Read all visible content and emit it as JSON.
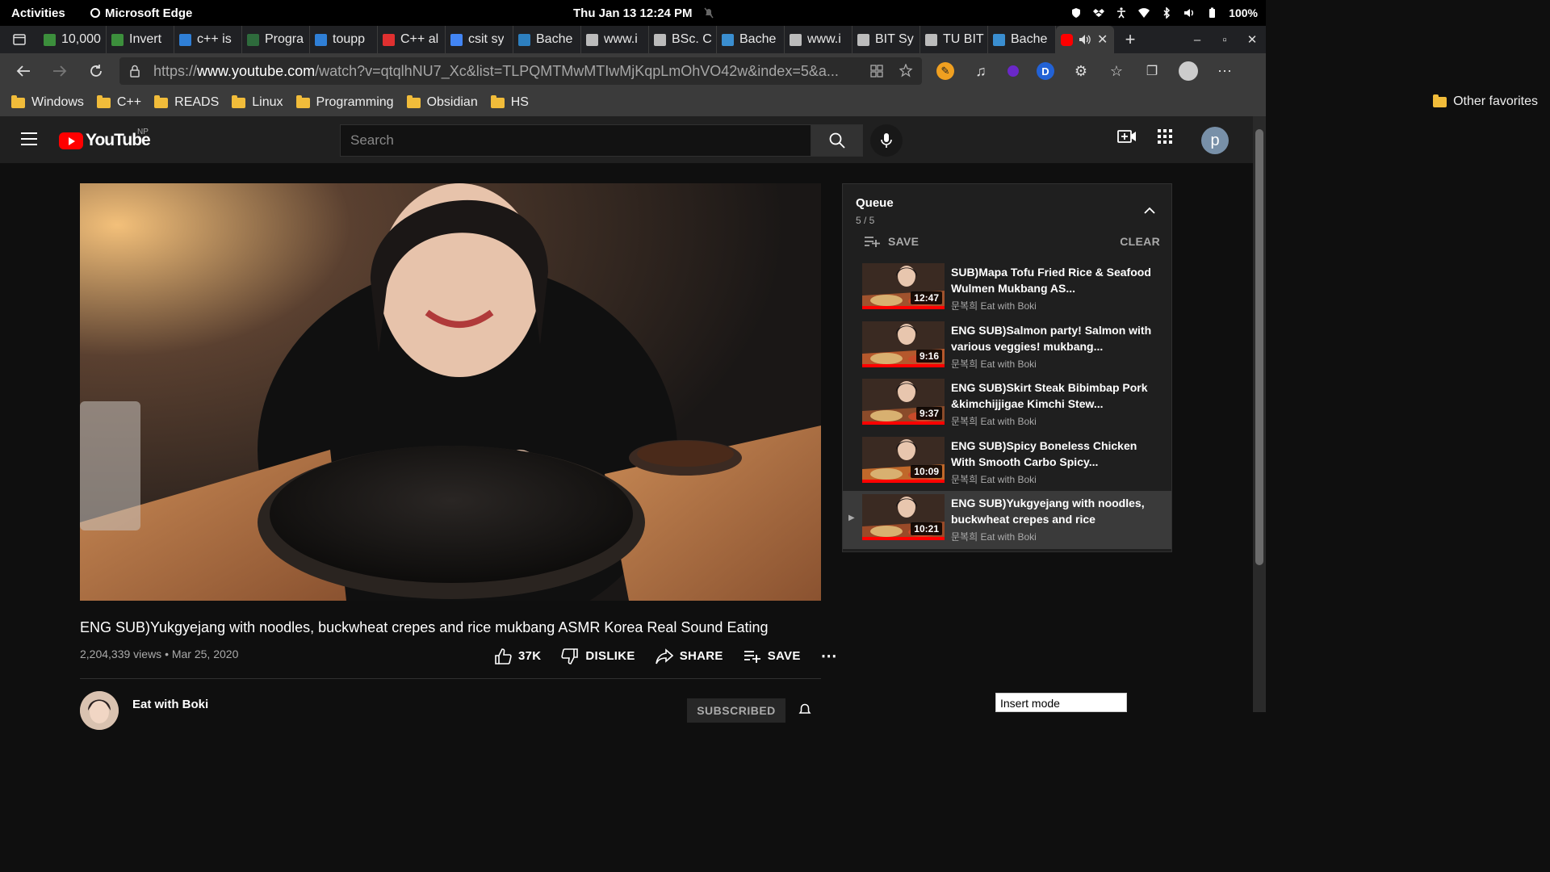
{
  "topbar": {
    "activities": "Activities",
    "app": "Microsoft Edge",
    "clock": "Thu Jan 13  12:24 PM",
    "battery": "100%"
  },
  "tabs": [
    {
      "label": "10,000",
      "color": "#3c8f3c"
    },
    {
      "label": "Invert",
      "color": "#3c8f3c"
    },
    {
      "label": "c++ is",
      "color": "#2f7fd6"
    },
    {
      "label": "Progra",
      "color": "#2e6b3c"
    },
    {
      "label": "toupp",
      "color": "#2f7fd6"
    },
    {
      "label": "C++ al",
      "color": "#e03030"
    },
    {
      "label": "csit sy",
      "color": "#4285f4"
    },
    {
      "label": "Bache",
      "color": "#2d7fbf"
    },
    {
      "label": "www.i",
      "color": "#bbbbbb"
    },
    {
      "label": "BSc. C",
      "color": "#bbbbbb"
    },
    {
      "label": "Bache",
      "color": "#3a8ed0"
    },
    {
      "label": "www.i",
      "color": "#bbbbbb"
    },
    {
      "label": "BIT Sy",
      "color": "#bbbbbb"
    },
    {
      "label": "TU BIT",
      "color": "#bbbbbb"
    },
    {
      "label": "Bache",
      "color": "#3a8ed0"
    }
  ],
  "address": {
    "prefix": "https://",
    "host": "www.youtube.com",
    "path": "/watch?v=qtqlhNU7_Xc&list=TLPQMTMwMTIwMjKqpLmOhVO42w&index=5&a..."
  },
  "bookmarks": [
    "Windows",
    "C++",
    "READS",
    "Linux",
    "Programming",
    "Obsidian",
    "HS"
  ],
  "other_favorites": "Other favorites",
  "youtube": {
    "logo_text": "YouTube",
    "region": "NP",
    "search_placeholder": "Search",
    "avatar_letter": "p"
  },
  "video": {
    "title": "ENG SUB)Yukgyejang with noodles, buckwheat crepes and rice mukbang ASMR Korea Real Sound Eating",
    "meta": "2,204,339 views • Mar 25, 2020",
    "likes": "37K",
    "dislike": "DISLIKE",
    "share": "SHARE",
    "save": "SAVE",
    "channel": "Eat with Boki",
    "subscribe": "SUBSCRIBED"
  },
  "queue": {
    "title": "Queue",
    "count": "5 / 5",
    "save": "SAVE",
    "clear": "CLEAR",
    "items": [
      {
        "title": "SUB)Mapa Tofu Fried Rice & Seafood Wulmen Mukbang AS...",
        "channel": "문복희 Eat with Boki",
        "duration": "12:47"
      },
      {
        "title": "ENG SUB)Salmon party! Salmon with various veggies! mukbang...",
        "channel": "문복희 Eat with Boki",
        "duration": "9:16"
      },
      {
        "title": "ENG SUB)Skirt Steak Bibimbap Pork &kimchijjigae Kimchi Stew...",
        "channel": "문복희 Eat with Boki",
        "duration": "9:37"
      },
      {
        "title": "ENG SUB)Spicy Boneless Chicken With Smooth Carbo Spicy...",
        "channel": "문복희 Eat with Boki",
        "duration": "10:09"
      },
      {
        "title": "ENG SUB)Yukgyejang with noodles, buckwheat crepes and rice mukbang...",
        "channel": "문복희 Eat with Boki",
        "duration": "10:21"
      }
    ]
  },
  "status": {
    "insert_mode": "Insert mode"
  }
}
